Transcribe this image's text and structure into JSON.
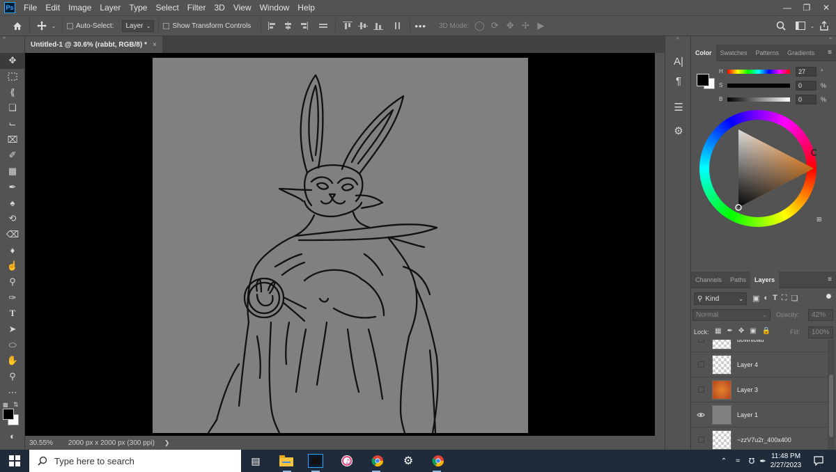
{
  "app": {
    "logo": "Ps",
    "menu": [
      "File",
      "Edit",
      "Image",
      "Layer",
      "Type",
      "Select",
      "Filter",
      "3D",
      "View",
      "Window",
      "Help"
    ]
  },
  "options": {
    "auto_select_label": "Auto-Select:",
    "auto_select_value": "Layer",
    "transform_label": "Show Transform Controls",
    "more": "•••",
    "mode_3d_label": "3D Mode:"
  },
  "document": {
    "tab_title": "Untitled-1 @ 30.6% (rabbt, RGB/8) *",
    "zoom": "30.55%",
    "size_info": "2000 px x 2000 px (300 ppi)"
  },
  "color_panel": {
    "tabs": [
      "Color",
      "Swatches",
      "Patterns",
      "Gradients"
    ],
    "h_label": "H",
    "h_value": "27",
    "h_unit": "°",
    "s_label": "S",
    "s_value": "0",
    "s_unit": "%",
    "b_label": "B",
    "b_value": "0",
    "b_unit": "%"
  },
  "layers_panel": {
    "tabs": [
      "Channels",
      "Paths",
      "Layers"
    ],
    "filter_label": "Kind",
    "blend_mode": "Normal",
    "opacity_label": "Opacity:",
    "opacity_value": "42%",
    "lock_label": "Lock:",
    "fill_label": "Fill:",
    "fill_value": "100%",
    "layers": [
      {
        "name": "download",
        "visible": false
      },
      {
        "name": "Layer 4",
        "visible": false
      },
      {
        "name": "Layer 3",
        "visible": false
      },
      {
        "name": "Layer 1",
        "visible": true
      },
      {
        "name": "~zzV7u2r_400x400",
        "visible": false
      }
    ]
  },
  "taskbar": {
    "search_placeholder": "Type here to search",
    "time": "11:48 PM",
    "date": "2/27/2023"
  },
  "colors": {
    "ui_bg": "#535353",
    "canvas_bg": "#808080",
    "taskbar": "#1f2b3a",
    "accent": "#31a8ff"
  }
}
